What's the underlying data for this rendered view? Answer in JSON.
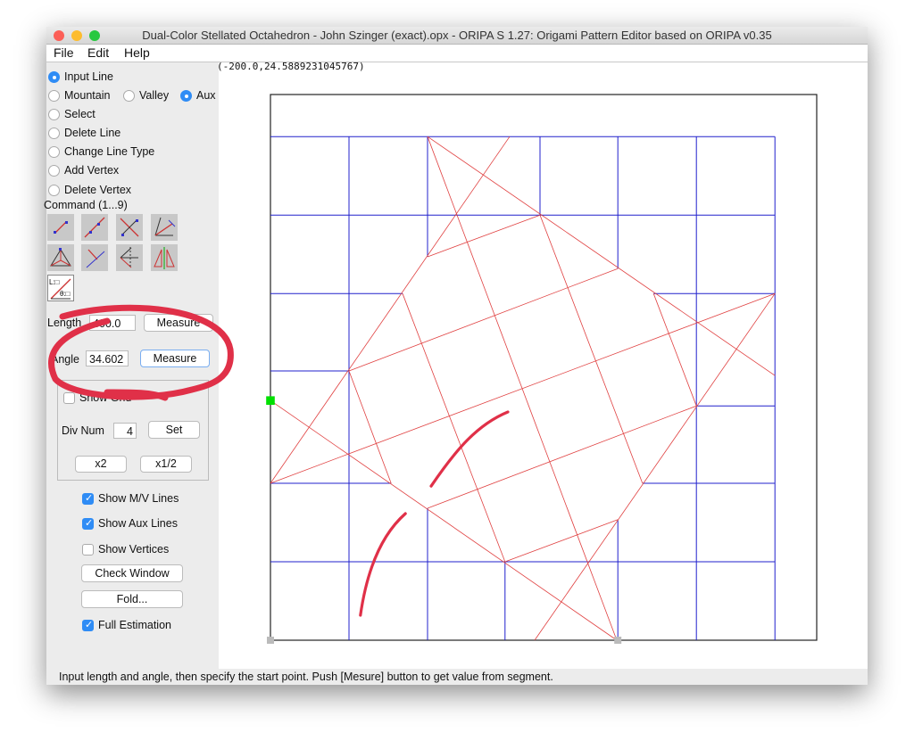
{
  "window": {
    "title": "Dual-Color Stellated Octahedron - John Szinger (exact).opx - ORIPA S 1.27: Origami Pattern Editor based on ORIPA  v0.35"
  },
  "menu": [
    "File",
    "Edit",
    "Help"
  ],
  "modes": {
    "input_line": "Input Line",
    "mountain": "Mountain",
    "valley": "Valley",
    "aux": "Aux",
    "select": "Select",
    "delete_line": "Delete Line",
    "change_line_type": "Change Line Type",
    "add_vertex": "Add Vertex",
    "delete_vertex": "Delete Vertex",
    "selected_mode": "Input Line",
    "selected_line_type": "Aux"
  },
  "command_label": "Command (1...9)",
  "tools": [
    "segment-by-two-points",
    "line-by-two-points",
    "perpendicular-bisector",
    "angle-bisector",
    "triangle-incenter",
    "perpendicular-line",
    "symmetric-line",
    "mirror-copy",
    "length-angle-input"
  ],
  "length": {
    "label": "Length",
    "value": "400.0",
    "button": "Measure"
  },
  "angle": {
    "label": "Angle",
    "value": "34.602",
    "button": "Measure"
  },
  "grid": {
    "show_grid_label": "Show Grid",
    "show_grid": false,
    "div_num_label": "Div Num",
    "div_num": "4",
    "set": "Set",
    "x2": "x2",
    "half": "x1/2"
  },
  "options": {
    "show_mv": "Show M/V Lines",
    "show_aux": "Show Aux Lines",
    "show_vertices": "Show Vertices",
    "check_window": "Check Window",
    "fold": "Fold...",
    "full_estimation": "Full Estimation",
    "show_mv_checked": true,
    "show_aux_checked": true,
    "show_vertices_checked": false,
    "full_estimation_checked": true
  },
  "canvas": {
    "coordinate_readout": "(-200.0,24.5889231045767)",
    "aux_color": "#0000cc",
    "crease_color": "#e03030",
    "selected_vertex_color": "#00e000"
  },
  "status": "Input length and angle, then specify the start point. Push [Mesure] button to get value from segment."
}
